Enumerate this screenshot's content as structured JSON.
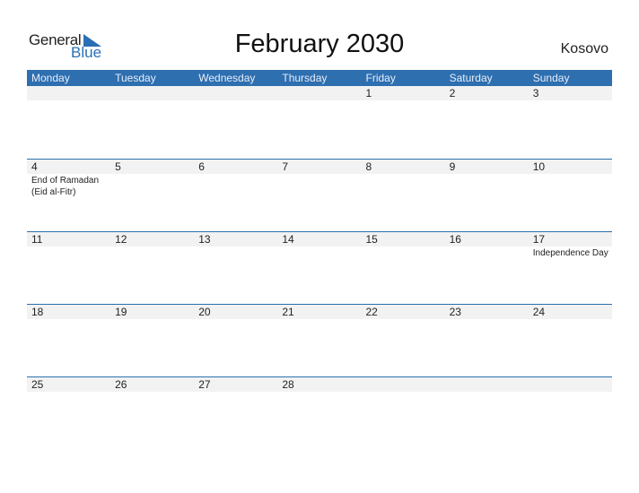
{
  "logo": {
    "general": "General",
    "blue": "Blue"
  },
  "title": "February 2030",
  "country": "Kosovo",
  "weekdays": [
    "Monday",
    "Tuesday",
    "Wednesday",
    "Thursday",
    "Friday",
    "Saturday",
    "Sunday"
  ],
  "weeks": [
    {
      "days": [
        "",
        "",
        "",
        "",
        "1",
        "2",
        "3"
      ],
      "events": [
        "",
        "",
        "",
        "",
        "",
        "",
        ""
      ]
    },
    {
      "days": [
        "4",
        "5",
        "6",
        "7",
        "8",
        "9",
        "10"
      ],
      "events": [
        "End of Ramadan (Eid al-Fitr)",
        "",
        "",
        "",
        "",
        "",
        ""
      ]
    },
    {
      "days": [
        "11",
        "12",
        "13",
        "14",
        "15",
        "16",
        "17"
      ],
      "events": [
        "",
        "",
        "",
        "",
        "",
        "",
        "Independence Day"
      ]
    },
    {
      "days": [
        "18",
        "19",
        "20",
        "21",
        "22",
        "23",
        "24"
      ],
      "events": [
        "",
        "",
        "",
        "",
        "",
        "",
        ""
      ]
    },
    {
      "days": [
        "25",
        "26",
        "27",
        "28",
        "",
        "",
        ""
      ],
      "events": [
        "",
        "",
        "",
        "",
        "",
        "",
        ""
      ]
    }
  ],
  "colors": {
    "accent": "#2e6fb0",
    "strip": "#f2f2f2"
  }
}
